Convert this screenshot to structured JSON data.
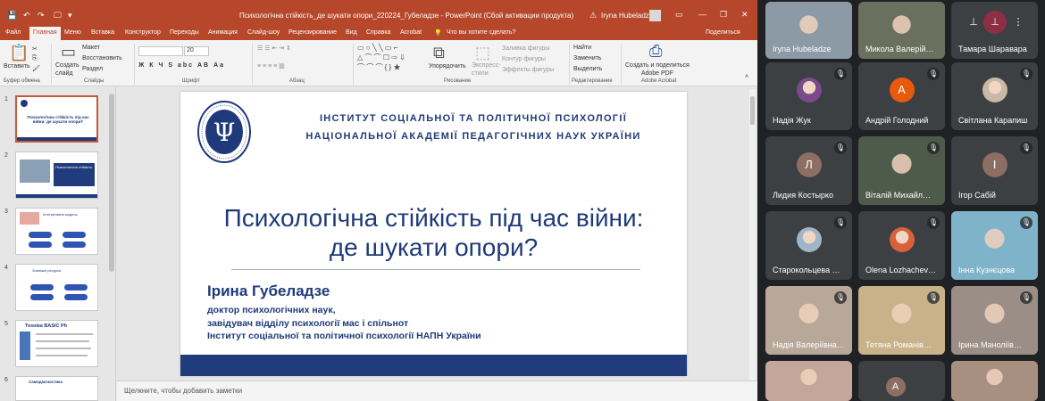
{
  "ppt": {
    "doc_title": "Психологічна стійкість_де шукати опори_220224_Губеладзе  -  PowerPoint (Сбой активации продукта)",
    "user": "Iryna Hubeladze",
    "window_controls": [
      "—",
      "❐",
      "✕"
    ],
    "quick_access": [
      "💾",
      "↶",
      "↷",
      "🖵",
      "▾"
    ],
    "tabs": [
      "Файл",
      "Главная",
      "Меню",
      "Вставка",
      "Конструктор",
      "Переходы",
      "Анимация",
      "Слайд-шоу",
      "Рецензирование",
      "Вид",
      "Справка",
      "Acrobat"
    ],
    "tell_me": "Что вы хотите сделать?",
    "share": "Поделиться",
    "ribbon": {
      "paste": "Вставить",
      "cut": "Макет",
      "restore": "Восстановить",
      "section": "Раздел",
      "new_slide": "Создать\nслайд",
      "font_size": "20",
      "font_styles": "Ж К Ч S abc АВ Аа",
      "shapes_arrange": "Упорядочить",
      "quick_styles": "Экспресс-\nстили",
      "shape_fill": "Заливка фигуры",
      "shape_outline": "Контур фигуры",
      "shape_effects": "Эффекты фигуры",
      "find": "Найти",
      "replace": "Заменить",
      "select": "Выделить",
      "adobe": "Создать и поделиться\nAdobe PDF",
      "groups": {
        "clipboard": "Буфер обмена",
        "slides": "Слайды",
        "font": "Шрифт",
        "paragraph": "Абзац",
        "drawing": "Рисование",
        "editing": "Редактирование",
        "acrobat": "Adobe Acrobat"
      }
    },
    "slide_numbers": [
      "1",
      "2",
      "3",
      "4",
      "5",
      "6"
    ],
    "thumb_texts": {
      "t1": "Психологічна стійкість під час війни: де шукати опори?",
      "t2": "Психологічна стійкість",
      "t3": "Інтегративна модель",
      "t4": "Зовнішні ресурси",
      "t5": "Техніка BASIC Ph",
      "t6": "Самодіагностика"
    },
    "notes_placeholder": "Щелкните, чтобы добавить заметки",
    "slide": {
      "institute_line1": "ІНСТИТУТ СОЦІАЛЬНОЇ ТА ПОЛІТИЧНОЇ ПСИХОЛОГІЇ",
      "institute_line2": "НАЦІОНАЛЬНОЇ АКАДЕМІЇ ПЕДАГОГІЧНИХ НАУК УКРАЇНИ",
      "title_line1": "Психологічна стійкість під час війни:",
      "title_line2": "де шукати опори?",
      "author": "Ірина Губеладзе",
      "info_line1": "доктор психологічних наук,",
      "info_line2": "завідувач відділу психології мас і спільнот",
      "info_line3": "Інститут соціальної та політичної психології НАПН України",
      "logo_glyph": "Ψ"
    }
  },
  "meet": {
    "participants": [
      {
        "name": "Iryna Hubeladze",
        "kind": "video",
        "bg": "#8c9aa6"
      },
      {
        "name": "Микола Валерій…",
        "kind": "video",
        "bg": "#6b6f5e"
      },
      {
        "name": "Тамара Шараварa",
        "kind": "controls",
        "bg": "#3c4043"
      },
      {
        "name": "Надія Жук",
        "kind": "photo",
        "bg": "#3c4043",
        "photo": "#7a4a8c"
      },
      {
        "name": "Андрій Голодний",
        "kind": "initial",
        "initial": "А",
        "bg": "#3c4043",
        "color": "#e8590c"
      },
      {
        "name": "Світлана Карапиш",
        "kind": "photo",
        "bg": "#3c4043",
        "photo": "#c8b8a8"
      },
      {
        "name": "Лидия Костырко",
        "kind": "initial",
        "initial": "Л",
        "bg": "#3c4043",
        "color": "#8d6e63"
      },
      {
        "name": "Віталій Михайл…",
        "kind": "video",
        "bg": "#4e5a4a"
      },
      {
        "name": "Ігор Сабій",
        "kind": "initial",
        "initial": "І",
        "bg": "#3c4043",
        "color": "#8d6e63"
      },
      {
        "name": "Старокольцева …",
        "kind": "photo",
        "bg": "#3c4043",
        "photo": "#9fb6c8"
      },
      {
        "name": "Olena Lozhachev…",
        "kind": "photo",
        "bg": "#3c4043",
        "photo": "#d8613c"
      },
      {
        "name": "Інна Кузнєцова",
        "kind": "video",
        "bg": "#7fb3c9"
      },
      {
        "name": "Надія Валеріївна…",
        "kind": "video",
        "bg": "#b8a89a"
      },
      {
        "name": "Тетяна Романів…",
        "kind": "video",
        "bg": "#c9b28a"
      },
      {
        "name": "Ірина Маноліїв…",
        "kind": "video",
        "bg": "#9a8e86"
      },
      {
        "name": "",
        "kind": "video",
        "bg": "#c4a79a"
      },
      {
        "name": "",
        "kind": "initial2",
        "initial": "А",
        "bg": "#3c4043",
        "color": "#8d6e63"
      },
      {
        "name": "",
        "kind": "video",
        "bg": "#a89080"
      }
    ],
    "mute_icon": "🎙",
    "pin_icon": "⊥",
    "more_icon": "⋮"
  }
}
